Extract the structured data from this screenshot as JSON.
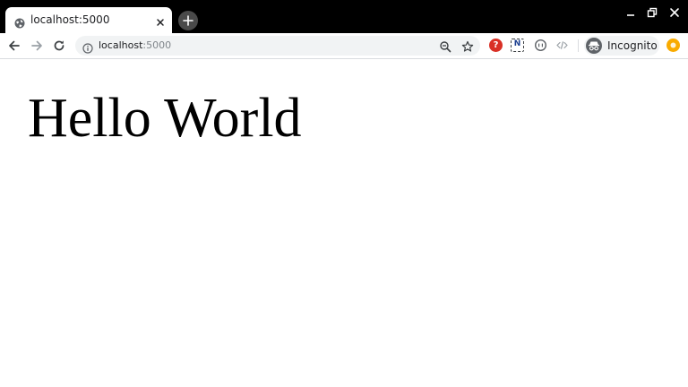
{
  "browser": {
    "tab": {
      "title": "localhost:5000"
    },
    "omnibox": {
      "host": "localhost",
      "port": ":5000"
    },
    "profile": {
      "label": "Incognito"
    },
    "icons": {
      "tab_favicon": "globe-icon",
      "tab_close": "close-icon",
      "new_tab": "plus-icon",
      "minimize": "minimize-icon",
      "restore": "restore-icon",
      "close_window": "close-icon",
      "back": "arrow-left-icon",
      "forward": "arrow-right-icon",
      "reload": "reload-icon",
      "site_info": "info-icon",
      "zoom": "zoom-out-icon",
      "bookmark": "star-icon",
      "extension_help": "help-icon",
      "extension_n": "n-icon",
      "extension_circle": "circle-icon",
      "extension_code": "code-icon",
      "profile_avatar": "incognito-icon",
      "extension_orange": "orange-circle-icon"
    },
    "colors": {
      "frame": "#000000",
      "toolbar": "#ffffff",
      "omnibox": "#f1f3f4",
      "help_extension": "#d93025",
      "orange_extension": "#f9ab00"
    }
  },
  "page": {
    "heading": "Hello World"
  }
}
